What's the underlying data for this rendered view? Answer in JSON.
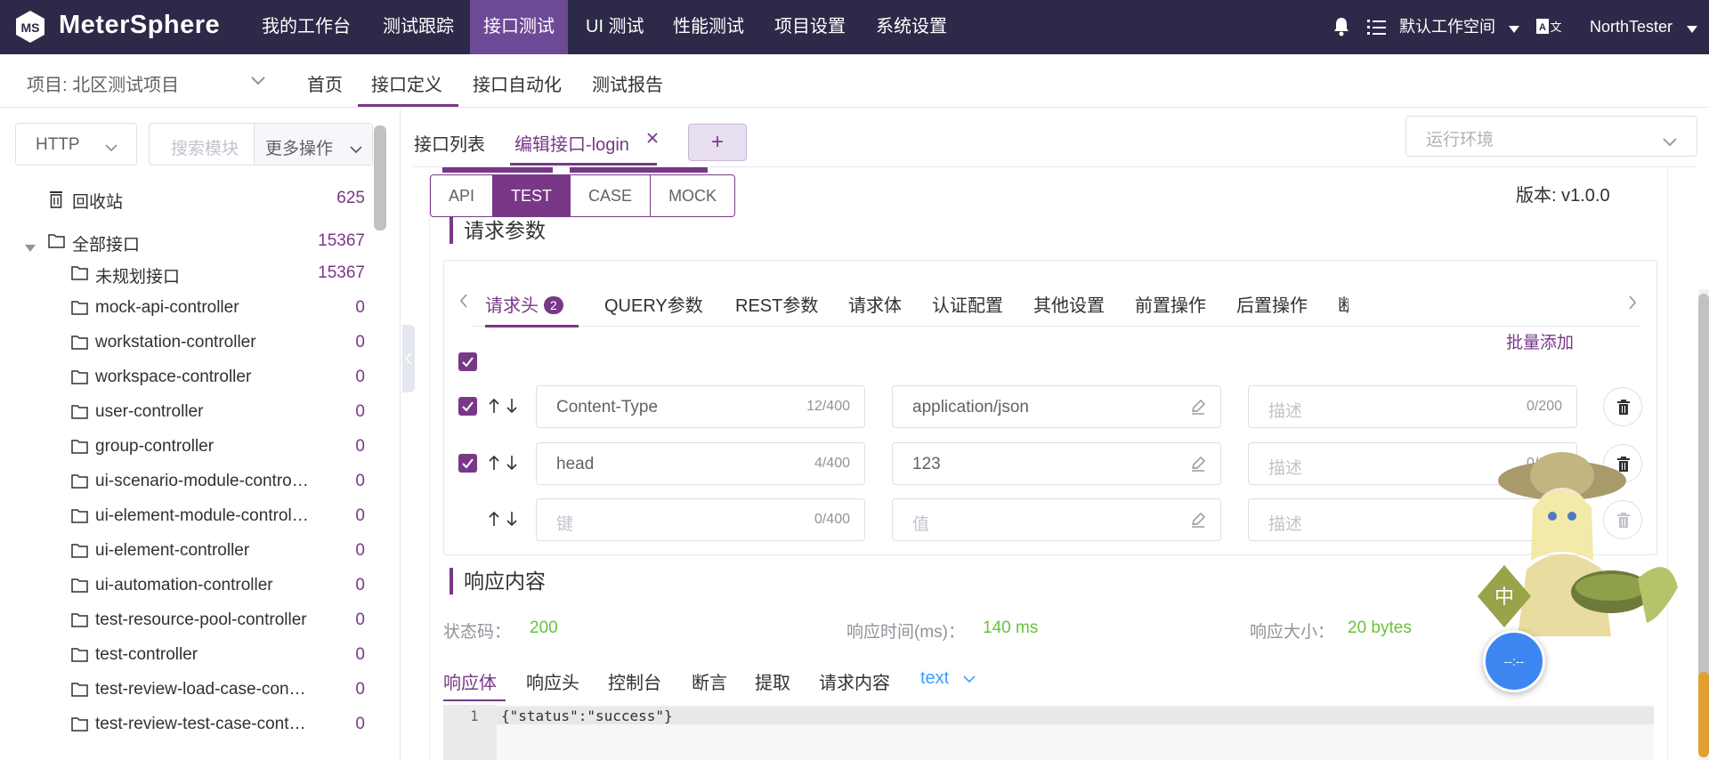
{
  "app": {
    "brand": "MeterSphere",
    "nav": [
      "我的工作台",
      "测试跟踪",
      "接口测试",
      "UI 测试",
      "性能测试",
      "项目设置",
      "系统设置"
    ],
    "active_nav_index": 2,
    "workspace": "默认工作空间",
    "user": "NorthTester"
  },
  "subbar": {
    "project": "项目: 北区测试项目",
    "tabs": [
      "首页",
      "接口定义",
      "接口自动化",
      "测试报告"
    ],
    "active_tab_index": 1
  },
  "sidebar": {
    "protocol": "HTTP",
    "search_placeholder": "搜索模块",
    "more_ops": "更多操作",
    "recycle": {
      "label": "回收站",
      "count": "625"
    },
    "all": {
      "label": "全部接口",
      "count": "15367"
    },
    "modules": [
      {
        "label": "未规划接口",
        "count": "15367"
      },
      {
        "label": "mock-api-controller",
        "count": "0"
      },
      {
        "label": "workstation-controller",
        "count": "0"
      },
      {
        "label": "workspace-controller",
        "count": "0"
      },
      {
        "label": "user-controller",
        "count": "0"
      },
      {
        "label": "group-controller",
        "count": "0"
      },
      {
        "label": "ui-scenario-module-contro…",
        "count": "0"
      },
      {
        "label": "ui-element-module-control…",
        "count": "0"
      },
      {
        "label": "ui-element-controller",
        "count": "0"
      },
      {
        "label": "ui-automation-controller",
        "count": "0"
      },
      {
        "label": "test-resource-pool-controller",
        "count": "0"
      },
      {
        "label": "test-controller",
        "count": "0"
      },
      {
        "label": "test-review-load-case-con…",
        "count": "0"
      },
      {
        "label": "test-review-test-case-cont…",
        "count": "0"
      }
    ]
  },
  "main": {
    "tab_list": "接口列表",
    "tab_edit": "编辑接口-login",
    "plus": "+",
    "env_placeholder": "运行环境",
    "mode_buttons": [
      "API",
      "TEST",
      "CASE",
      "MOCK"
    ],
    "active_mode_index": 1,
    "version": "版本: v1.0.0",
    "request_title": "请求参数",
    "param_tabs": [
      "请求头",
      "QUERY参数",
      "REST参数",
      "请求体",
      "认证配置",
      "其他设置",
      "前置操作",
      "后置操作",
      "断"
    ],
    "header_badge": "2",
    "batch_add": "批量添加",
    "headers": [
      {
        "checked": true,
        "key": "Content-Type",
        "key_count": "12/400",
        "value": "application/json",
        "desc_placeholder": "描述",
        "desc_count": "0/200"
      },
      {
        "checked": true,
        "key": "head",
        "key_count": "4/400",
        "value": "123",
        "desc_placeholder": "描述",
        "desc_count": "0/200"
      },
      {
        "checked": false,
        "key_placeholder": "键",
        "key_count": "0/400",
        "value_placeholder": "值",
        "desc_placeholder": "描述",
        "desc_count": "0"
      }
    ],
    "response_title": "响应内容",
    "status_label": "状态码：",
    "status_value": "200",
    "time_label": "响应时间(ms)：",
    "time_value": "140 ms",
    "size_label": "响应大小：",
    "size_value": "20 bytes",
    "resp_tabs": [
      "响应体",
      "响应头",
      "控制台",
      "断言",
      "提取",
      "请求内容"
    ],
    "format": "text",
    "code_line_no": "1",
    "code_line": "{\"status\":\"success\"}",
    "float_btn": "--:--"
  },
  "colors": {
    "accent": "#783887",
    "topbar": "#2c2a48",
    "success": "#67c23a",
    "link": "#409eff"
  }
}
